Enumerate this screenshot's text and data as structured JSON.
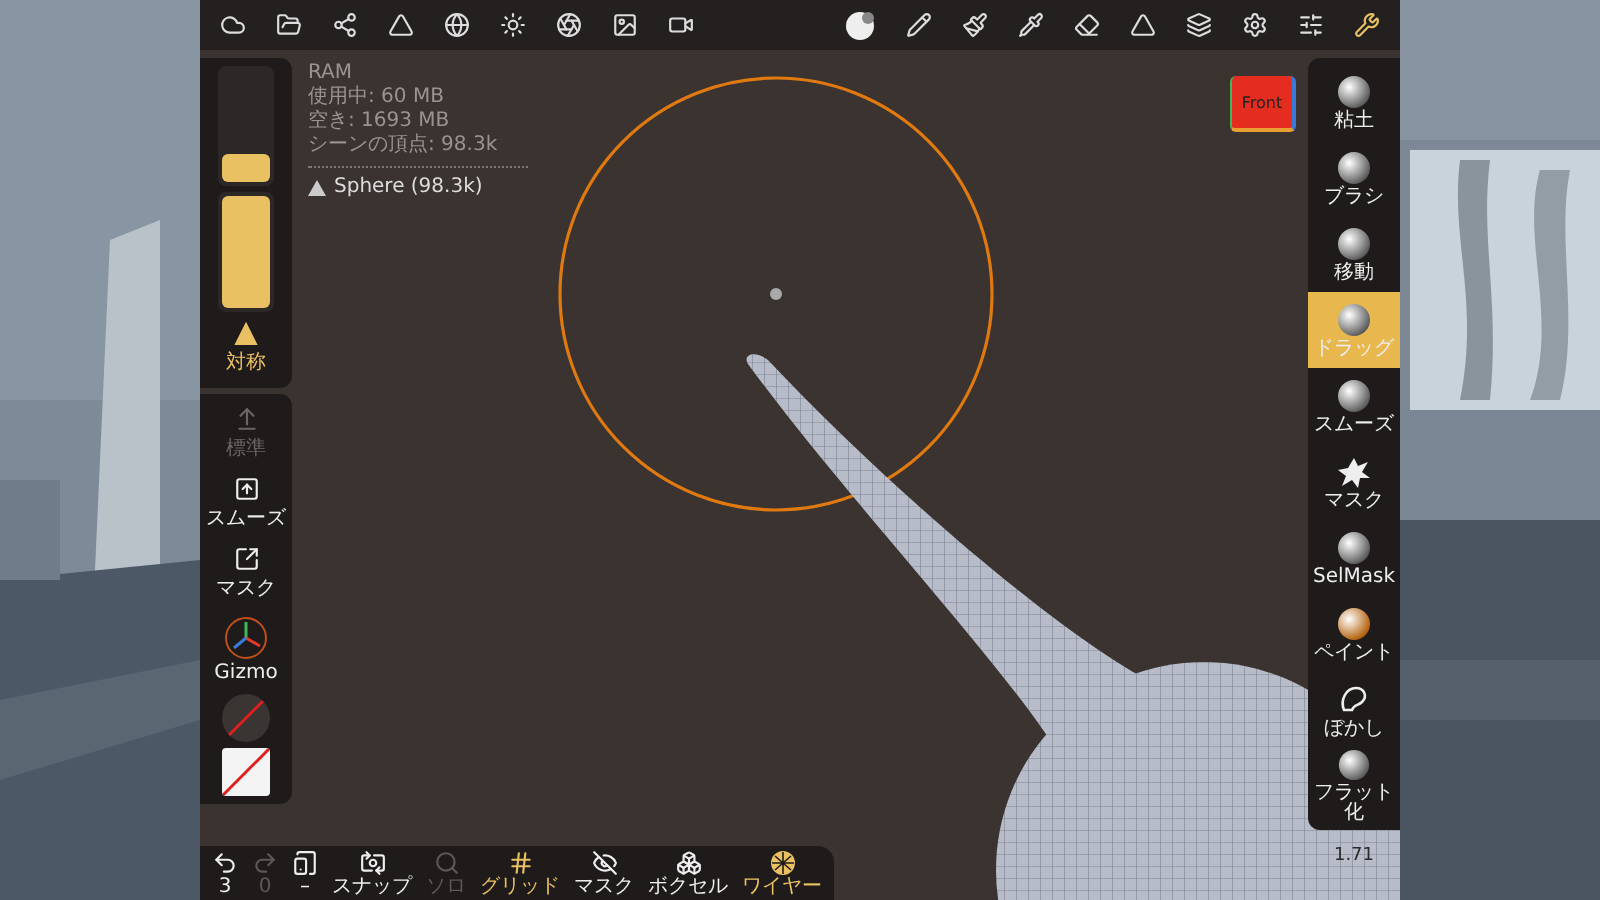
{
  "stats": {
    "lines": [
      "RAM",
      "使用中: 60 MB",
      "空き: 1693 MB",
      "シーンの頂点: 98.3k"
    ],
    "object": "Sphere (98.3k)"
  },
  "left_panel": {
    "sliders": [
      {
        "level": 0.25
      },
      {
        "level": 1
      }
    ],
    "symmetry": {
      "label": "対称",
      "on": true
    },
    "tools": [
      {
        "label": "標準",
        "kind": "standard",
        "disabled": true
      },
      {
        "label": "スムーズ",
        "kind": "smooth",
        "disabled": false
      },
      {
        "label": "マスク",
        "kind": "mask",
        "disabled": false
      },
      {
        "label": "Gizmo",
        "kind": "gizmo",
        "disabled": false
      }
    ]
  },
  "view_cube": {
    "label": "Front"
  },
  "brushes": [
    {
      "label": "粘土",
      "kind": "sphere",
      "selected": false
    },
    {
      "label": "ブラシ",
      "kind": "sphere",
      "selected": false
    },
    {
      "label": "移動",
      "kind": "sphere",
      "selected": false
    },
    {
      "label": "ドラッグ",
      "kind": "sphere",
      "selected": true
    },
    {
      "label": "スムーズ",
      "kind": "sphere",
      "selected": false
    },
    {
      "label": "マスク",
      "kind": "splat",
      "selected": false
    },
    {
      "label": "SelMask",
      "kind": "sphere",
      "selected": false
    },
    {
      "label": "ペイント",
      "kind": "paint",
      "selected": false
    },
    {
      "label": "ぼかし",
      "kind": "outline",
      "selected": false
    },
    {
      "label": "フラット化",
      "kind": "sphere",
      "selected": false
    }
  ],
  "corner_reading": "1.71",
  "bottom_toolbar": [
    {
      "label": "3",
      "kind": "undo",
      "on": false,
      "disabled": false
    },
    {
      "label": "0",
      "kind": "redo",
      "on": false,
      "disabled": true
    },
    {
      "label": "–",
      "kind": "tablet",
      "on": false,
      "disabled": false
    },
    {
      "label": "スナップ",
      "kind": "snap",
      "on": false,
      "disabled": false
    },
    {
      "label": "ソロ",
      "kind": "solo",
      "on": false,
      "disabled": true
    },
    {
      "label": "グリッド",
      "kind": "grid",
      "on": true,
      "disabled": false
    },
    {
      "label": "マスク",
      "kind": "mask",
      "on": false,
      "disabled": false
    },
    {
      "label": "ボクセル",
      "kind": "voxel",
      "on": false,
      "disabled": false
    },
    {
      "label": "ワイヤー",
      "kind": "wire",
      "on": true,
      "disabled": false
    }
  ]
}
